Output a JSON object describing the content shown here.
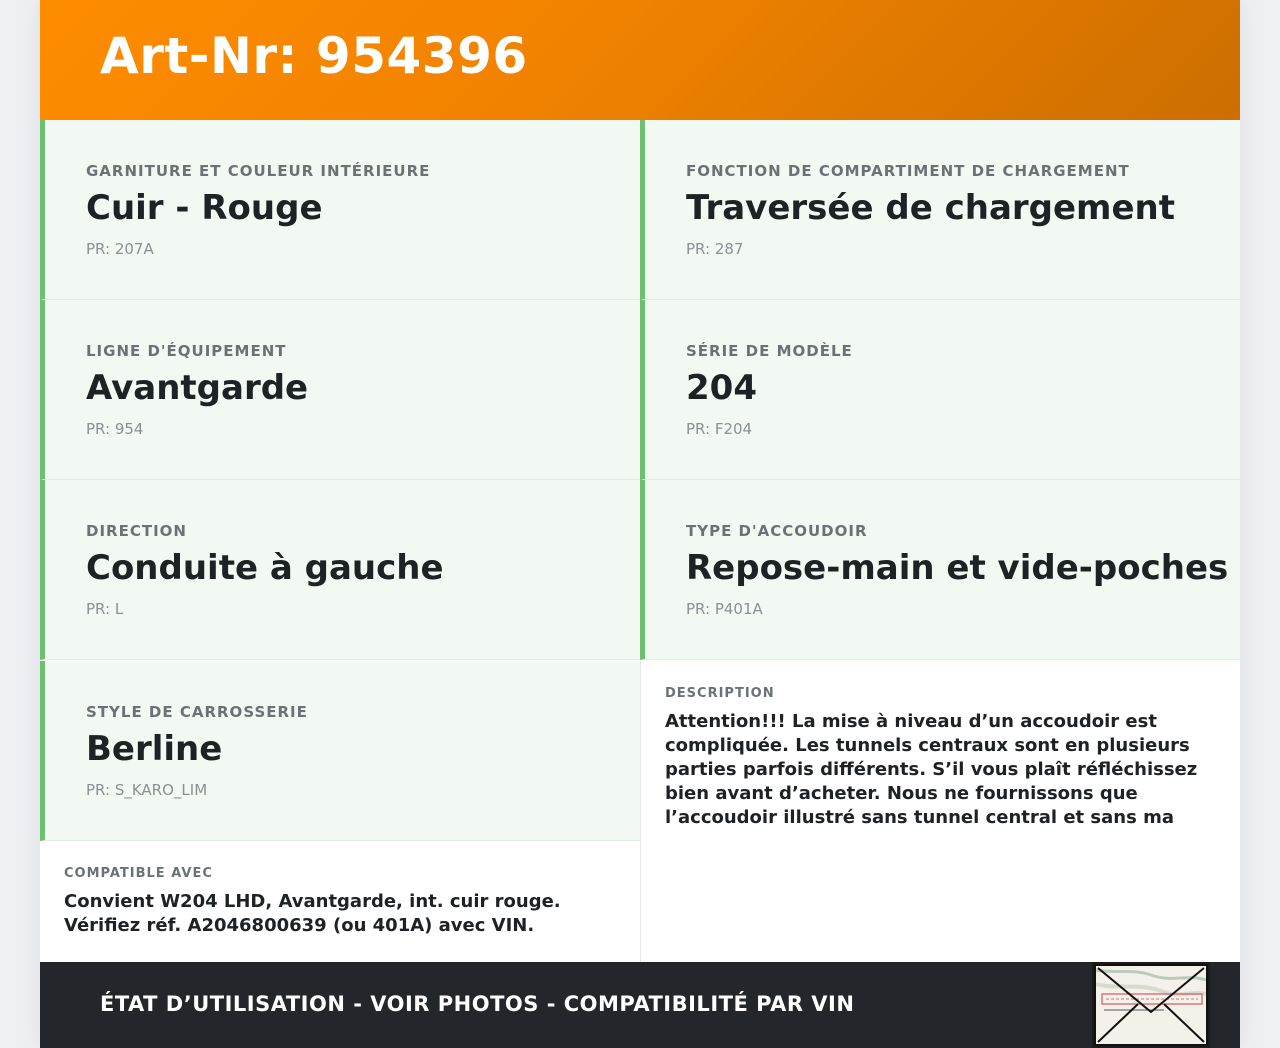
{
  "header": {
    "title": "Art-Nr: 954396"
  },
  "specs": [
    {
      "label": "Garniture et couleur intérieure",
      "value": "Cuir - Rouge",
      "pr": "PR: 207A"
    },
    {
      "label": "Fonction de compartiment de chargement",
      "value": "Traversée de chargement",
      "pr": "PR: 287"
    },
    {
      "label": "Ligne d'équipement",
      "value": "Avantgarde",
      "pr": "PR: 954"
    },
    {
      "label": "Série de modèle",
      "value": "204",
      "pr": "PR: F204"
    },
    {
      "label": "Direction",
      "value": "Conduite à gauche",
      "pr": "PR: L"
    },
    {
      "label": "Type d'accoudoir",
      "value": "Repose-main et vide-poches",
      "pr": "PR: P401A"
    },
    {
      "label": "Style de carrosserie",
      "value": "Berline",
      "pr": "PR: S_KARO_LIM"
    }
  ],
  "compatible": {
    "label": "Compatible avec",
    "text": "Convient W204 LHD, Avantgarde, int. cuir rouge. Vérifiez réf. A2046800639 (ou 401A) avec VIN."
  },
  "description": {
    "label": "Description",
    "text": "Attention!!! La mise à niveau d’un accoudoir est compliquée. Les tunnels centraux sont en plusieurs parties parfois différents. S’il vous plaît réfléchissez bien avant d’acheter. Nous ne fournissons que l’accoudoir illustré sans tunnel central et sans ma"
  },
  "footer": {
    "text": "ÉTAT D’UTILISATION - VOIR PHOTOS - COMPATIBILITÉ PAR VIN"
  },
  "colors": {
    "header_orange": "#ff8c00",
    "accent_green": "#6cc070",
    "spec_bg": "#f2f9f2",
    "footer_dark": "#23262b"
  }
}
